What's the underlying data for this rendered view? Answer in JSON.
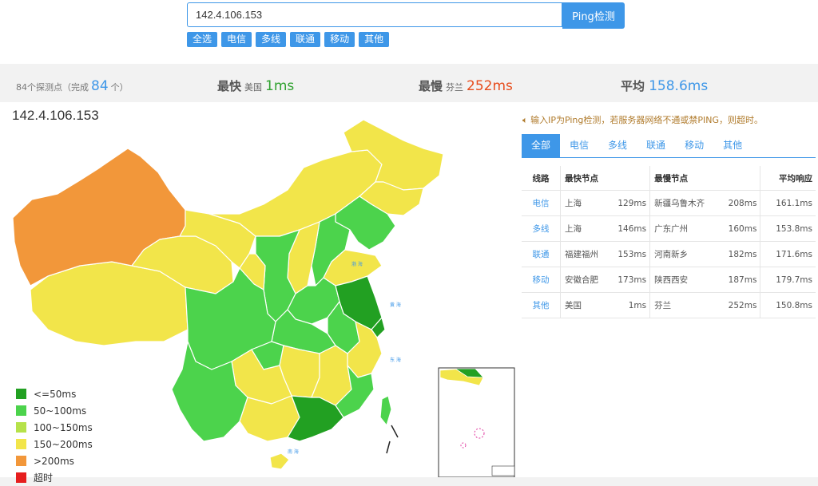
{
  "search": {
    "value": "142.4.106.153",
    "button": "Ping检测"
  },
  "filters": [
    "全选",
    "电信",
    "多线",
    "联通",
    "移动",
    "其他"
  ],
  "stats": {
    "probe_prefix": "84个探测点（完成",
    "probe_done": "84",
    "probe_suffix": "个）",
    "fastest_label": "最快",
    "fastest_loc": "美国",
    "fastest_value": "1ms",
    "slowest_label": "最慢",
    "slowest_loc": "芬兰",
    "slowest_value": "252ms",
    "avg_label": "平均",
    "avg_value": "158.6ms"
  },
  "map": {
    "ip": "142.4.106.153",
    "legend": [
      {
        "label": "<=50ms",
        "color": "#22a022"
      },
      {
        "label": "50~100ms",
        "color": "#4cd34c"
      },
      {
        "label": "100~150ms",
        "color": "#b6e24a"
      },
      {
        "label": "150~200ms",
        "color": "#f2e54a"
      },
      {
        "label": ">200ms",
        "color": "#f2973a"
      },
      {
        "label": "超时",
        "color": "#e61e1e"
      }
    ]
  },
  "notice": "输入IP为Ping检测，若服务器网络不通或禁PING，则超时。",
  "tabs": [
    "全部",
    "电信",
    "多线",
    "联通",
    "移动",
    "其他"
  ],
  "table": {
    "headers": [
      "线路",
      "最快节点",
      "最慢节点",
      "平均响应"
    ],
    "rows": [
      {
        "line": "电信",
        "fast_node": "上海",
        "fast_ms": "129ms",
        "slow_node": "新疆乌鲁木齐",
        "slow_ms": "208ms",
        "avg": "161.1ms"
      },
      {
        "line": "多线",
        "fast_node": "上海",
        "fast_ms": "146ms",
        "slow_node": "广东广州",
        "slow_ms": "160ms",
        "avg": "153.8ms"
      },
      {
        "line": "联通",
        "fast_node": "福建福州",
        "fast_ms": "153ms",
        "slow_node": "河南新乡",
        "slow_ms": "182ms",
        "avg": "171.6ms"
      },
      {
        "line": "移动",
        "fast_node": "安徽合肥",
        "fast_ms": "173ms",
        "slow_node": "陕西西安",
        "slow_ms": "187ms",
        "avg": "179.7ms"
      },
      {
        "line": "其他",
        "fast_node": "美国",
        "fast_ms": "1ms",
        "slow_node": "芬兰",
        "slow_ms": "252ms",
        "avg": "150.8ms"
      }
    ]
  }
}
